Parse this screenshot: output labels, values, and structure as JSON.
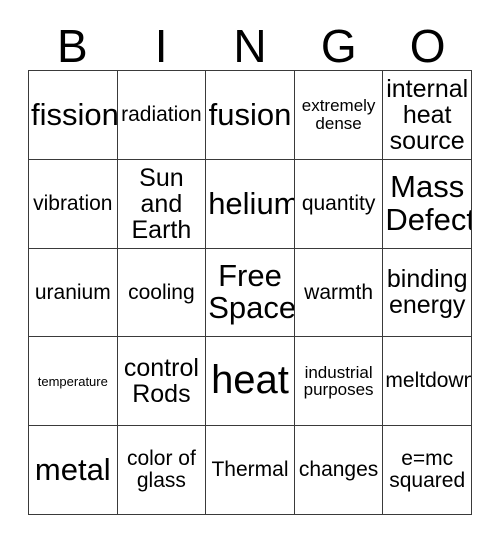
{
  "card": {
    "header_letters": [
      "B",
      "I",
      "N",
      "G",
      "O"
    ],
    "grid": {
      "columns": 5,
      "rows": 5,
      "border_color": "#3a3a3a",
      "cell_background": "#ffffff",
      "text_color": "#000000"
    },
    "cells": [
      {
        "text": "fission",
        "size": "xl"
      },
      {
        "text": "radiation",
        "size": "md"
      },
      {
        "text": "fusion",
        "size": "xl"
      },
      {
        "text": "extremely dense",
        "size": "sm"
      },
      {
        "text": "internal heat source",
        "size": "lg"
      },
      {
        "text": "vibration",
        "size": "md"
      },
      {
        "text": "Sun and Earth",
        "size": "lg"
      },
      {
        "text": "helium",
        "size": "xl"
      },
      {
        "text": "quantity",
        "size": "md"
      },
      {
        "text": "Mass Defect",
        "size": "xl"
      },
      {
        "text": "uranium",
        "size": "md"
      },
      {
        "text": "cooling",
        "size": "md"
      },
      {
        "text": "Free Space",
        "size": "xl"
      },
      {
        "text": "warmth",
        "size": "md"
      },
      {
        "text": "binding energy",
        "size": "lg"
      },
      {
        "text": "temperature",
        "size": "xs"
      },
      {
        "text": "control Rods",
        "size": "lg"
      },
      {
        "text": "heat",
        "size": "xxl"
      },
      {
        "text": "industrial purposes",
        "size": "sm"
      },
      {
        "text": "meltdown",
        "size": "md"
      },
      {
        "text": "metal",
        "size": "xl"
      },
      {
        "text": "color of glass",
        "size": "md"
      },
      {
        "text": "Thermal",
        "size": "md"
      },
      {
        "text": "changes",
        "size": "md"
      },
      {
        "text": "e=mc squared",
        "size": "md"
      }
    ]
  }
}
